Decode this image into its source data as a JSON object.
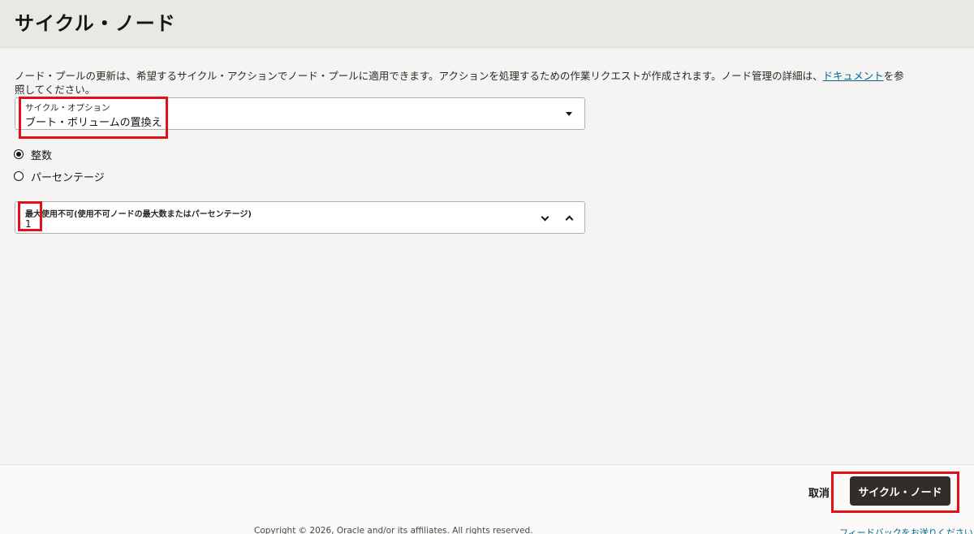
{
  "header": {
    "title": "サイクル・ノード"
  },
  "intro": {
    "text_before_link": "ノード・プールの更新は、希望するサイクル・アクションでノード・プールに適用できます。アクションを処理するための作業リクエストが作成されます。ノード管理の詳細は、",
    "link_text": "ドキュメント",
    "text_after_link": "を参照してください。"
  },
  "cycle_option": {
    "label": "サイクル・オプション",
    "value": "ブート・ボリュームの置換え"
  },
  "mode_radio": {
    "options": [
      {
        "label": "整数",
        "checked": true
      },
      {
        "label": "パーセンテージ",
        "checked": false
      }
    ]
  },
  "max_unavailable": {
    "label": "最大使用不可(使用不可ノードの最大数またはパーセンテージ)",
    "value": "1"
  },
  "footer": {
    "cancel_label": "取消",
    "submit_label": "サイクル・ノード",
    "copyright": "Copyright © 2026, Oracle and/or its affiliates. All rights reserved.",
    "feedback": "フィードバックをお送りください"
  },
  "colors": {
    "primary_button": "#312d2a",
    "link": "#00688c",
    "highlight": "#e0111b"
  }
}
